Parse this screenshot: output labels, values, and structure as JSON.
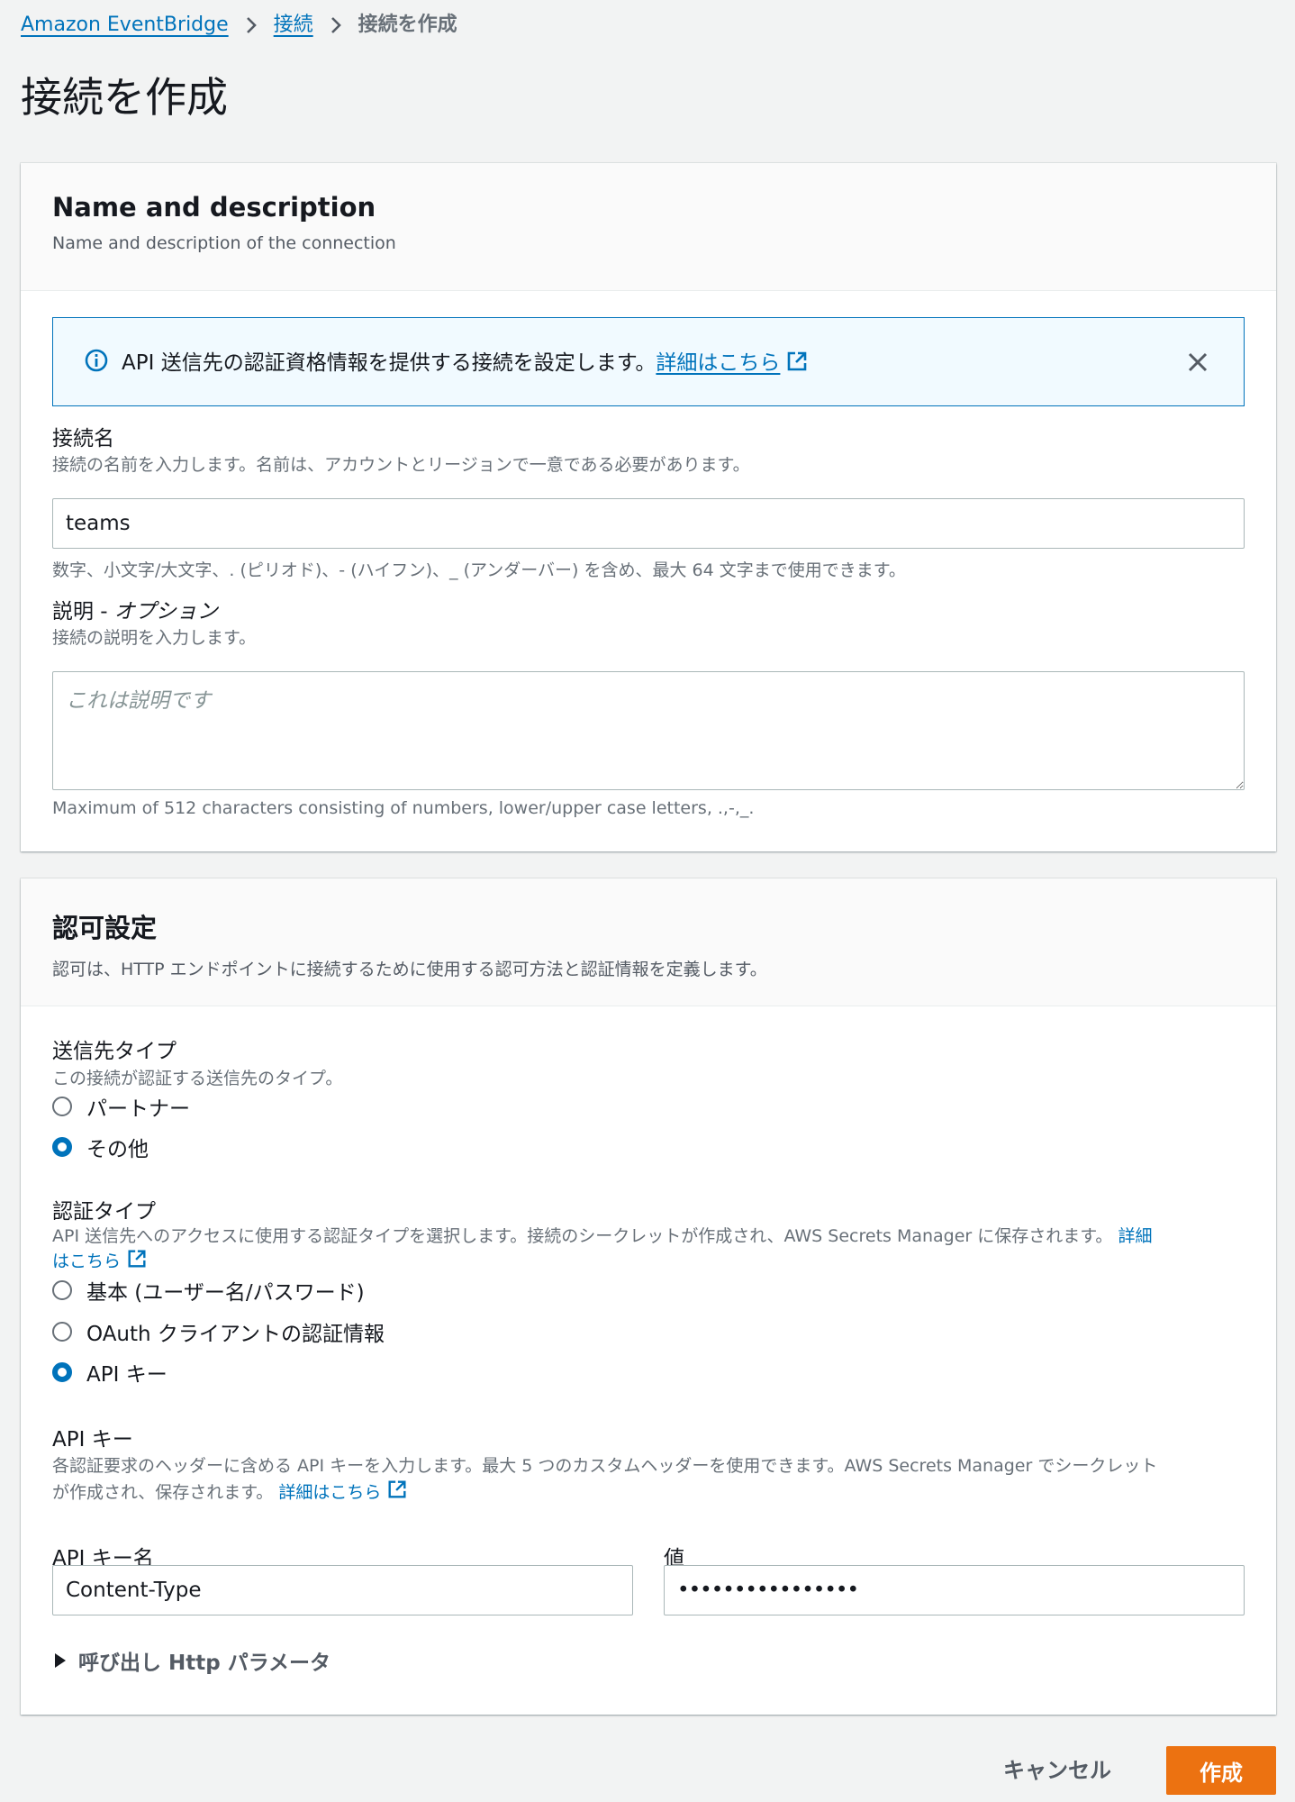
{
  "breadcrumb": {
    "items": [
      "Amazon EventBridge",
      "接続",
      "接続を作成"
    ]
  },
  "page_title": "接続を作成",
  "name_section": {
    "title": "Name and description",
    "description": "Name and description of the connection",
    "info_alert": {
      "text": "API 送信先の認証資格情報を提供する接続を設定します。",
      "link": "詳細はこちら"
    },
    "connection_name": {
      "label": "接続名",
      "description": "接続の名前を入力します。名前は、アカウントとリージョンで一意である必要があります。",
      "value": "teams",
      "constraint": "数字、小文字/大文字、. (ピリオド)、- (ハイフン)、_ (アンダーバー) を含め、最大 64 文字まで使用できます。"
    },
    "description_field": {
      "label": "説明 - ",
      "label_optional": "オプション",
      "description": "接続の説明を入力します。",
      "placeholder": "これは説明です",
      "constraint": "Maximum of 512 characters consisting of numbers, lower/upper case letters, .,-,_."
    }
  },
  "auth_section": {
    "title": "認可設定",
    "description": "認可は、HTTP エンドポイントに接続するために使用する認可方法と認証情報を定義します。",
    "destination_type": {
      "label": "送信先タイプ",
      "description": "この接続が認証する送信先のタイプ。",
      "options": [
        "パートナー",
        "その他"
      ],
      "selected": "その他"
    },
    "auth_type": {
      "label": "認証タイプ",
      "description_line1": "API 送信先へのアクセスに使用する認証タイプを選択します。接続のシークレットが作成され、AWS Secrets Manager に保存されます。",
      "link_part1": "詳細",
      "link_part2": "はこちら",
      "options": [
        "基本 (ユーザー名/パスワード)",
        "OAuth クライアントの認証情報",
        "API キー"
      ],
      "selected": "API キー"
    },
    "api_key": {
      "label": "API キー",
      "description_line1": "各認証要求のヘッダーに含める API キーを入力します。最大 5 つのカスタムヘッダーを使用できます。AWS Secrets Manager でシークレット",
      "description_line2": "が作成され、保存されます。",
      "link": "詳細はこちら",
      "name_label": "API キー名",
      "name_value": "Content-Type",
      "value_label": "値",
      "value_masked": "••••••••••••••••"
    },
    "http_params_label": "呼び出し Http パラメータ"
  },
  "footer": {
    "cancel_label": "キャンセル",
    "create_label": "作成"
  },
  "colors": {
    "link": "#0073bb",
    "primary_button": "#ec7211",
    "alert_bg": "#f1faff"
  }
}
